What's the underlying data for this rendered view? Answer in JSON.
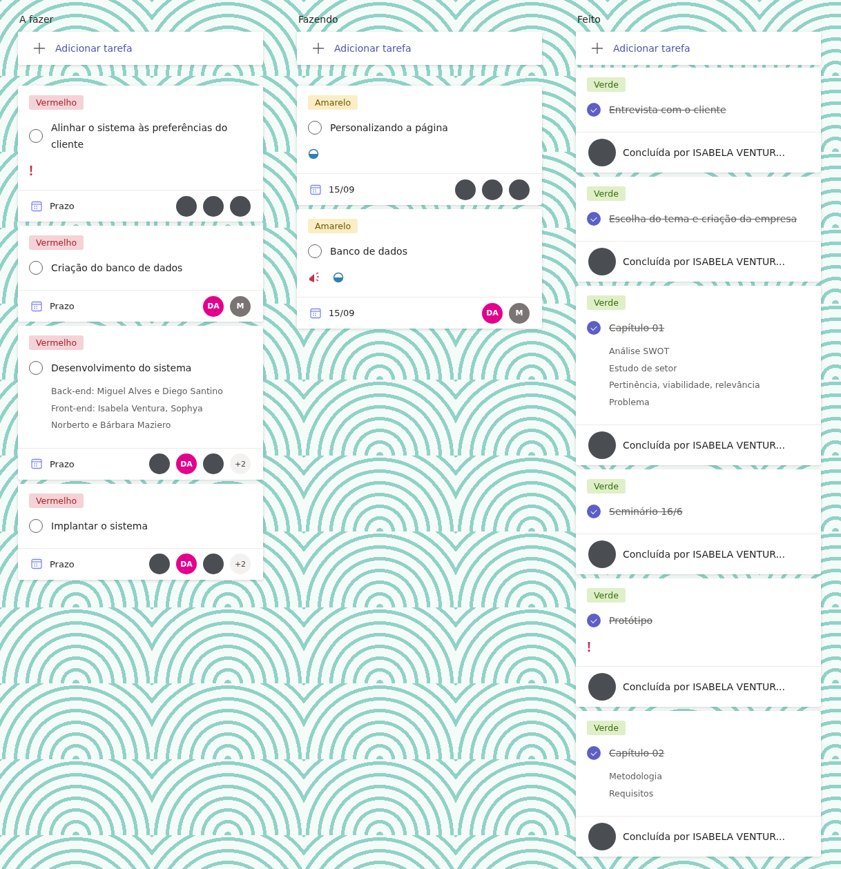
{
  "columns": [
    {
      "title": "A fazer",
      "add_label": "Adicionar tarefa",
      "cards": [
        {
          "label": {
            "text": "Vermelho",
            "kind": "red"
          },
          "title": "Alinhar o sistema às preferências do cliente",
          "checked": false,
          "indicators": [
            {
              "kind": "urgent"
            }
          ],
          "footer": {
            "kind": "due",
            "due": "Prazo",
            "avatars": [
              {
                "kind": "photo"
              },
              {
                "kind": "photo"
              },
              {
                "kind": "photo"
              }
            ]
          }
        },
        {
          "label": {
            "text": "Vermelho",
            "kind": "red"
          },
          "title": "Criação do banco de dados",
          "checked": false,
          "footer": {
            "kind": "due",
            "due": "Prazo",
            "avatars": [
              {
                "kind": "initials",
                "text": "DA",
                "color": "#e3008c"
              },
              {
                "kind": "initials",
                "text": "M",
                "color": "#7a7574"
              }
            ]
          }
        },
        {
          "label": {
            "text": "Vermelho",
            "kind": "red"
          },
          "title": "Desenvolvimento do sistema",
          "checked": false,
          "notes": [
            "Back-end: Miguel Alves e Diego Santino",
            "Front-end: Isabela Ventura, Sophya",
            "Norberto e Bárbara Maziero"
          ],
          "footer": {
            "kind": "due",
            "due": "Prazo",
            "avatars": [
              {
                "kind": "photo"
              },
              {
                "kind": "initials",
                "text": "DA",
                "color": "#e3008c"
              },
              {
                "kind": "photo"
              }
            ],
            "overflow": "+2"
          }
        },
        {
          "label": {
            "text": "Vermelho",
            "kind": "red"
          },
          "title": "Implantar o sistema",
          "checked": false,
          "footer": {
            "kind": "due",
            "due": "Prazo",
            "avatars": [
              {
                "kind": "photo"
              },
              {
                "kind": "initials",
                "text": "DA",
                "color": "#e3008c"
              },
              {
                "kind": "photo"
              }
            ],
            "overflow": "+2"
          }
        }
      ]
    },
    {
      "title": "Fazendo",
      "add_label": "Adicionar tarefa",
      "cards": [
        {
          "label": {
            "text": "Amarelo",
            "kind": "yellow"
          },
          "title": "Personalizando a página",
          "checked": false,
          "indicators": [
            {
              "kind": "progress"
            }
          ],
          "footer": {
            "kind": "due",
            "due": "15/09",
            "avatars": [
              {
                "kind": "photo"
              },
              {
                "kind": "photo"
              },
              {
                "kind": "photo"
              }
            ]
          }
        },
        {
          "label": {
            "text": "Amarelo",
            "kind": "yellow"
          },
          "title": "Banco de dados",
          "checked": false,
          "indicators": [
            {
              "kind": "alert"
            },
            {
              "kind": "progress"
            }
          ],
          "footer": {
            "kind": "due",
            "due": "15/09",
            "avatars": [
              {
                "kind": "initials",
                "text": "DA",
                "color": "#e3008c"
              },
              {
                "kind": "initials",
                "text": "M",
                "color": "#7a7574"
              }
            ]
          }
        }
      ]
    },
    {
      "title": "Feito",
      "add_label": "Adicionar tarefa",
      "cards": [
        {
          "label": {
            "text": "Verde",
            "kind": "green"
          },
          "title": "Entrevista com o cliente",
          "checked": true,
          "footer": {
            "kind": "completed",
            "text": "Concluída por ISABELA VENTUR..."
          }
        },
        {
          "label": {
            "text": "Verde",
            "kind": "green"
          },
          "title": "Escolha do tema e criação da empresa",
          "checked": true,
          "footer": {
            "kind": "completed",
            "text": "Concluída por ISABELA VENTUR..."
          }
        },
        {
          "label": {
            "text": "Verde",
            "kind": "green"
          },
          "title": "Capítulo 01",
          "checked": true,
          "notes": [
            "Análise SWOT",
            "Estudo de setor",
            "Pertinência, viabilidade, relevância",
            "Problema"
          ],
          "footer": {
            "kind": "completed",
            "text": "Concluída por ISABELA VENTUR..."
          }
        },
        {
          "label": {
            "text": "Verde",
            "kind": "green"
          },
          "title": "Seminário 16/6",
          "checked": true,
          "footer": {
            "kind": "completed",
            "text": "Concluída por ISABELA VENTUR..."
          }
        },
        {
          "label": {
            "text": "Verde",
            "kind": "green"
          },
          "title": "Protótipo",
          "checked": true,
          "indicators": [
            {
              "kind": "urgent"
            }
          ],
          "footer": {
            "kind": "completed",
            "text": "Concluída por ISABELA VENTUR..."
          }
        },
        {
          "label": {
            "text": "Verde",
            "kind": "green"
          },
          "title": "Capítulo 02",
          "checked": true,
          "notes": [
            "Metodologia",
            "Requisitos"
          ],
          "footer": {
            "kind": "completed",
            "text": "Concluída por ISABELA VENTUR..."
          }
        }
      ]
    }
  ]
}
